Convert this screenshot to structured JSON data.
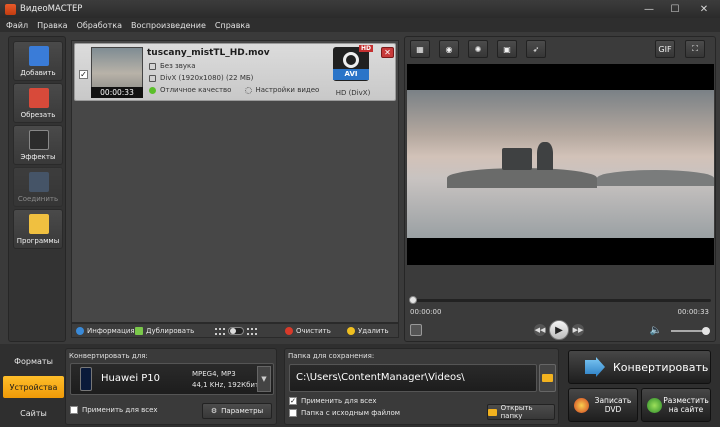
{
  "window": {
    "title": "ВидеоМАСТЕР",
    "minimize": "—",
    "maximize": "☐",
    "close": "✕"
  },
  "menu": [
    "Файл",
    "Правка",
    "Обработка",
    "Воспроизведение",
    "Справка"
  ],
  "sidebar": [
    {
      "label": "Добавить",
      "icon": "add-video-icon",
      "color": "#3a7cd8"
    },
    {
      "label": "Обрезать",
      "icon": "cut-icon",
      "color": "#d84a3a"
    },
    {
      "label": "Эффекты",
      "icon": "effects-icon",
      "color": "#2c2c2c"
    },
    {
      "label": "Соединить",
      "icon": "join-icon",
      "color": "#5c7ea6"
    },
    {
      "label": "Программы",
      "icon": "programs-icon",
      "color": "#f0c040"
    }
  ],
  "file": {
    "checked": "✓",
    "name": "tuscany_mistTL_HD.mov",
    "duration": "00:00:33",
    "audio": "Без звука",
    "video": "DivX (1920x1080) (22 МБ)",
    "quality": "Отличное качество",
    "settings": "Настройки видео",
    "format_badge": "AVI",
    "hd_badge": "HD",
    "format_caption": "HD (DivX)",
    "remove": "✕"
  },
  "file_tools": {
    "info": "Информация",
    "duplicate": "Дублировать",
    "clear": "Очистить",
    "delete": "Удалить"
  },
  "player": {
    "tools": [
      "crop-icon",
      "snapshot-icon",
      "brightness-icon",
      "rotate-icon",
      "speed-icon"
    ],
    "gif": "GIF",
    "time_current": "00:00:00",
    "time_total": "00:00:33",
    "progress": 0,
    "volume": 1
  },
  "bottom": {
    "tabs": [
      "Форматы",
      "Устройства",
      "Сайты"
    ],
    "active_tab": 1,
    "convert_for_label": "Конвертировать для:",
    "device": "Huawei P10",
    "device_spec1": "MPEG4, MP3",
    "device_spec2": "44,1 KHz, 192Кбит",
    "apply_all": "Применить для всех",
    "params": "Параметры",
    "save_label": "Папка для сохранения:",
    "save_path": "C:\\Users\\ContentManager\\Videos\\",
    "save_apply_all": "Применить для всех",
    "source_folder": "Папка с исходным файлом",
    "open_folder": "Открыть папку",
    "convert": "Конвертировать",
    "dvd": "Записать DVD",
    "web": "Разместить на сайте"
  },
  "colors": {
    "accent": "#f5a712",
    "play_blue": "#2a74c8"
  }
}
